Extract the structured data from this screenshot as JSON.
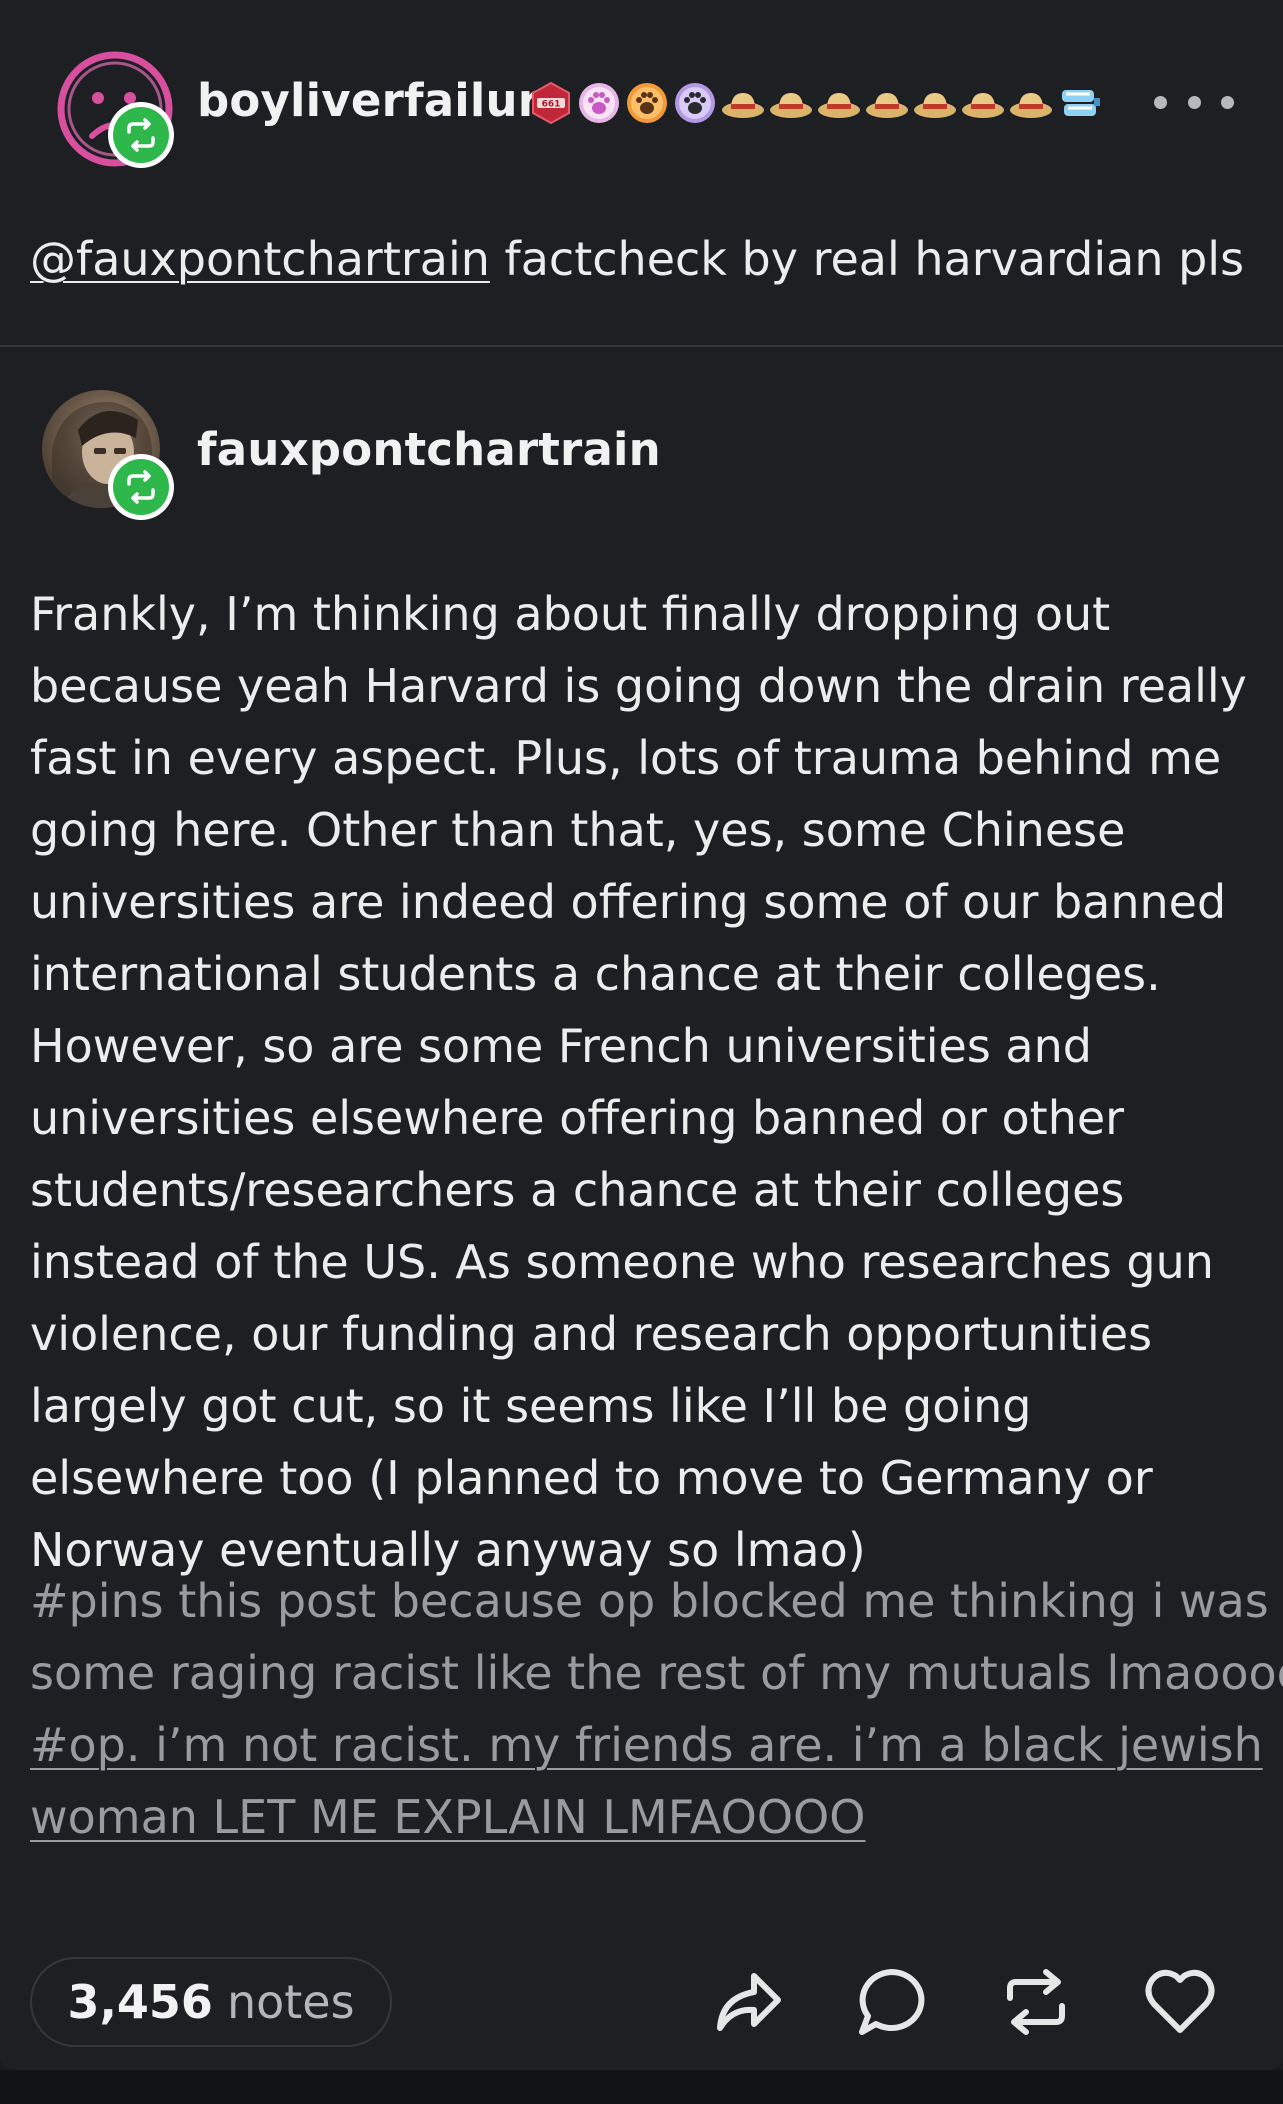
{
  "reblogger": {
    "name": "boyliverfailure",
    "badge_number": "661",
    "badge_icons": [
      "gem-badge-icon",
      "paw-badge-icon",
      "paw-badge-icon",
      "paw-badge-icon",
      "hat-badge-icon",
      "hat-badge-icon",
      "hat-badge-icon",
      "hat-badge-icon",
      "hat-badge-icon",
      "hat-badge-icon",
      "hat-badge-icon",
      "teeth-badge-icon"
    ]
  },
  "reblog_comment": {
    "mention": "@fauxpontchartrain",
    "text": " factcheck by real harvardian pls"
  },
  "original": {
    "name": "fauxpontchartrain",
    "body": "Frankly, I’m thinking about finally dropping out because yeah Harvard is going down the drain really fast in every aspect. Plus, lots of trauma behind me going here. Other than that, yes, some Chinese universities are indeed offering some of our banned international students a chance at their colleges. However, so are some French universities and universities elsewhere offering banned or other students/researchers a chance at their colleges instead of the US. As someone who researches gun violence, our funding and research opportunities largely got cut, so it seems like I’ll be going elsewhere too (I planned to move to Germany or Norway eventually anyway so lmao)"
  },
  "tags": {
    "line1": "#pins this post because op blocked me thinking i was",
    "line2": "some raging racist like the rest of my mutuals lmaoooo",
    "line3": "#op. i’m not racist. my friends are. i’m a black jewish ",
    "line4": "woman LET ME EXPLAIN LMFAOOOO"
  },
  "footer": {
    "notes_count": "3,456",
    "notes_label": "notes"
  },
  "colors": {
    "background": "#1e1f23",
    "reblog_green": "#2eb84b",
    "text": "#ececec",
    "muted": "#9a9ba0"
  }
}
